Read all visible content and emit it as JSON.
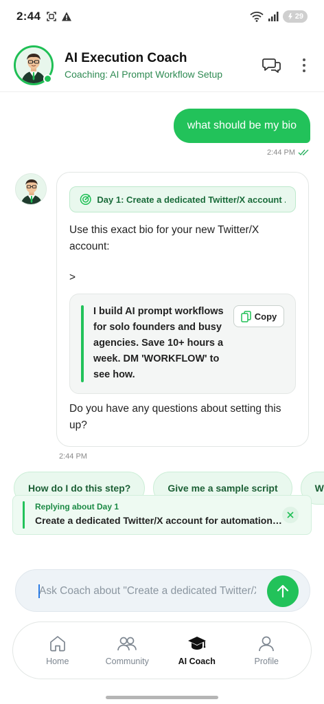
{
  "status_bar": {
    "time": "2:44",
    "battery_level": "29"
  },
  "header": {
    "title": "AI Execution Coach",
    "subtitle": "Coaching: AI Prompt Workflow Setup",
    "avatar_icon": "coach-avatar",
    "online": true
  },
  "chat": {
    "user_message": {
      "text": "what should be my bio",
      "time": "2:44 PM",
      "read": true
    },
    "bot_message": {
      "task_label": "Day 1: Create a dedicated Twitter/X account ...",
      "intro": "Use this exact bio for your new Twitter/X account:",
      "marker": ">",
      "bio": "I build AI prompt workflows for solo founders and busy agencies. Save 10+ hours a week. DM 'WORKFLOW' to see how.",
      "copy_label": "Copy",
      "outro": "Do you have any questions about setting this up?",
      "time": "2:44 PM"
    }
  },
  "suggestions": [
    "How do I do this step?",
    "Give me a sample script",
    "What if t"
  ],
  "reply": {
    "label": "Replying about Day 1",
    "text": "Create a dedicated Twitter/X account for automation h..."
  },
  "composer": {
    "placeholder": "Ask Coach about \"Create a dedicated Twitter/X"
  },
  "nav": {
    "items": [
      {
        "label": "Home",
        "icon": "home-icon",
        "active": false
      },
      {
        "label": "Community",
        "icon": "community-icon",
        "active": false
      },
      {
        "label": "AI Coach",
        "icon": "graduation-cap-icon",
        "active": true
      },
      {
        "label": "Profile",
        "icon": "profile-icon",
        "active": false
      }
    ]
  },
  "colors": {
    "accent": "#22c25a",
    "accent_dark": "#1c5f35",
    "chip_bg": "#e9f8ee"
  }
}
